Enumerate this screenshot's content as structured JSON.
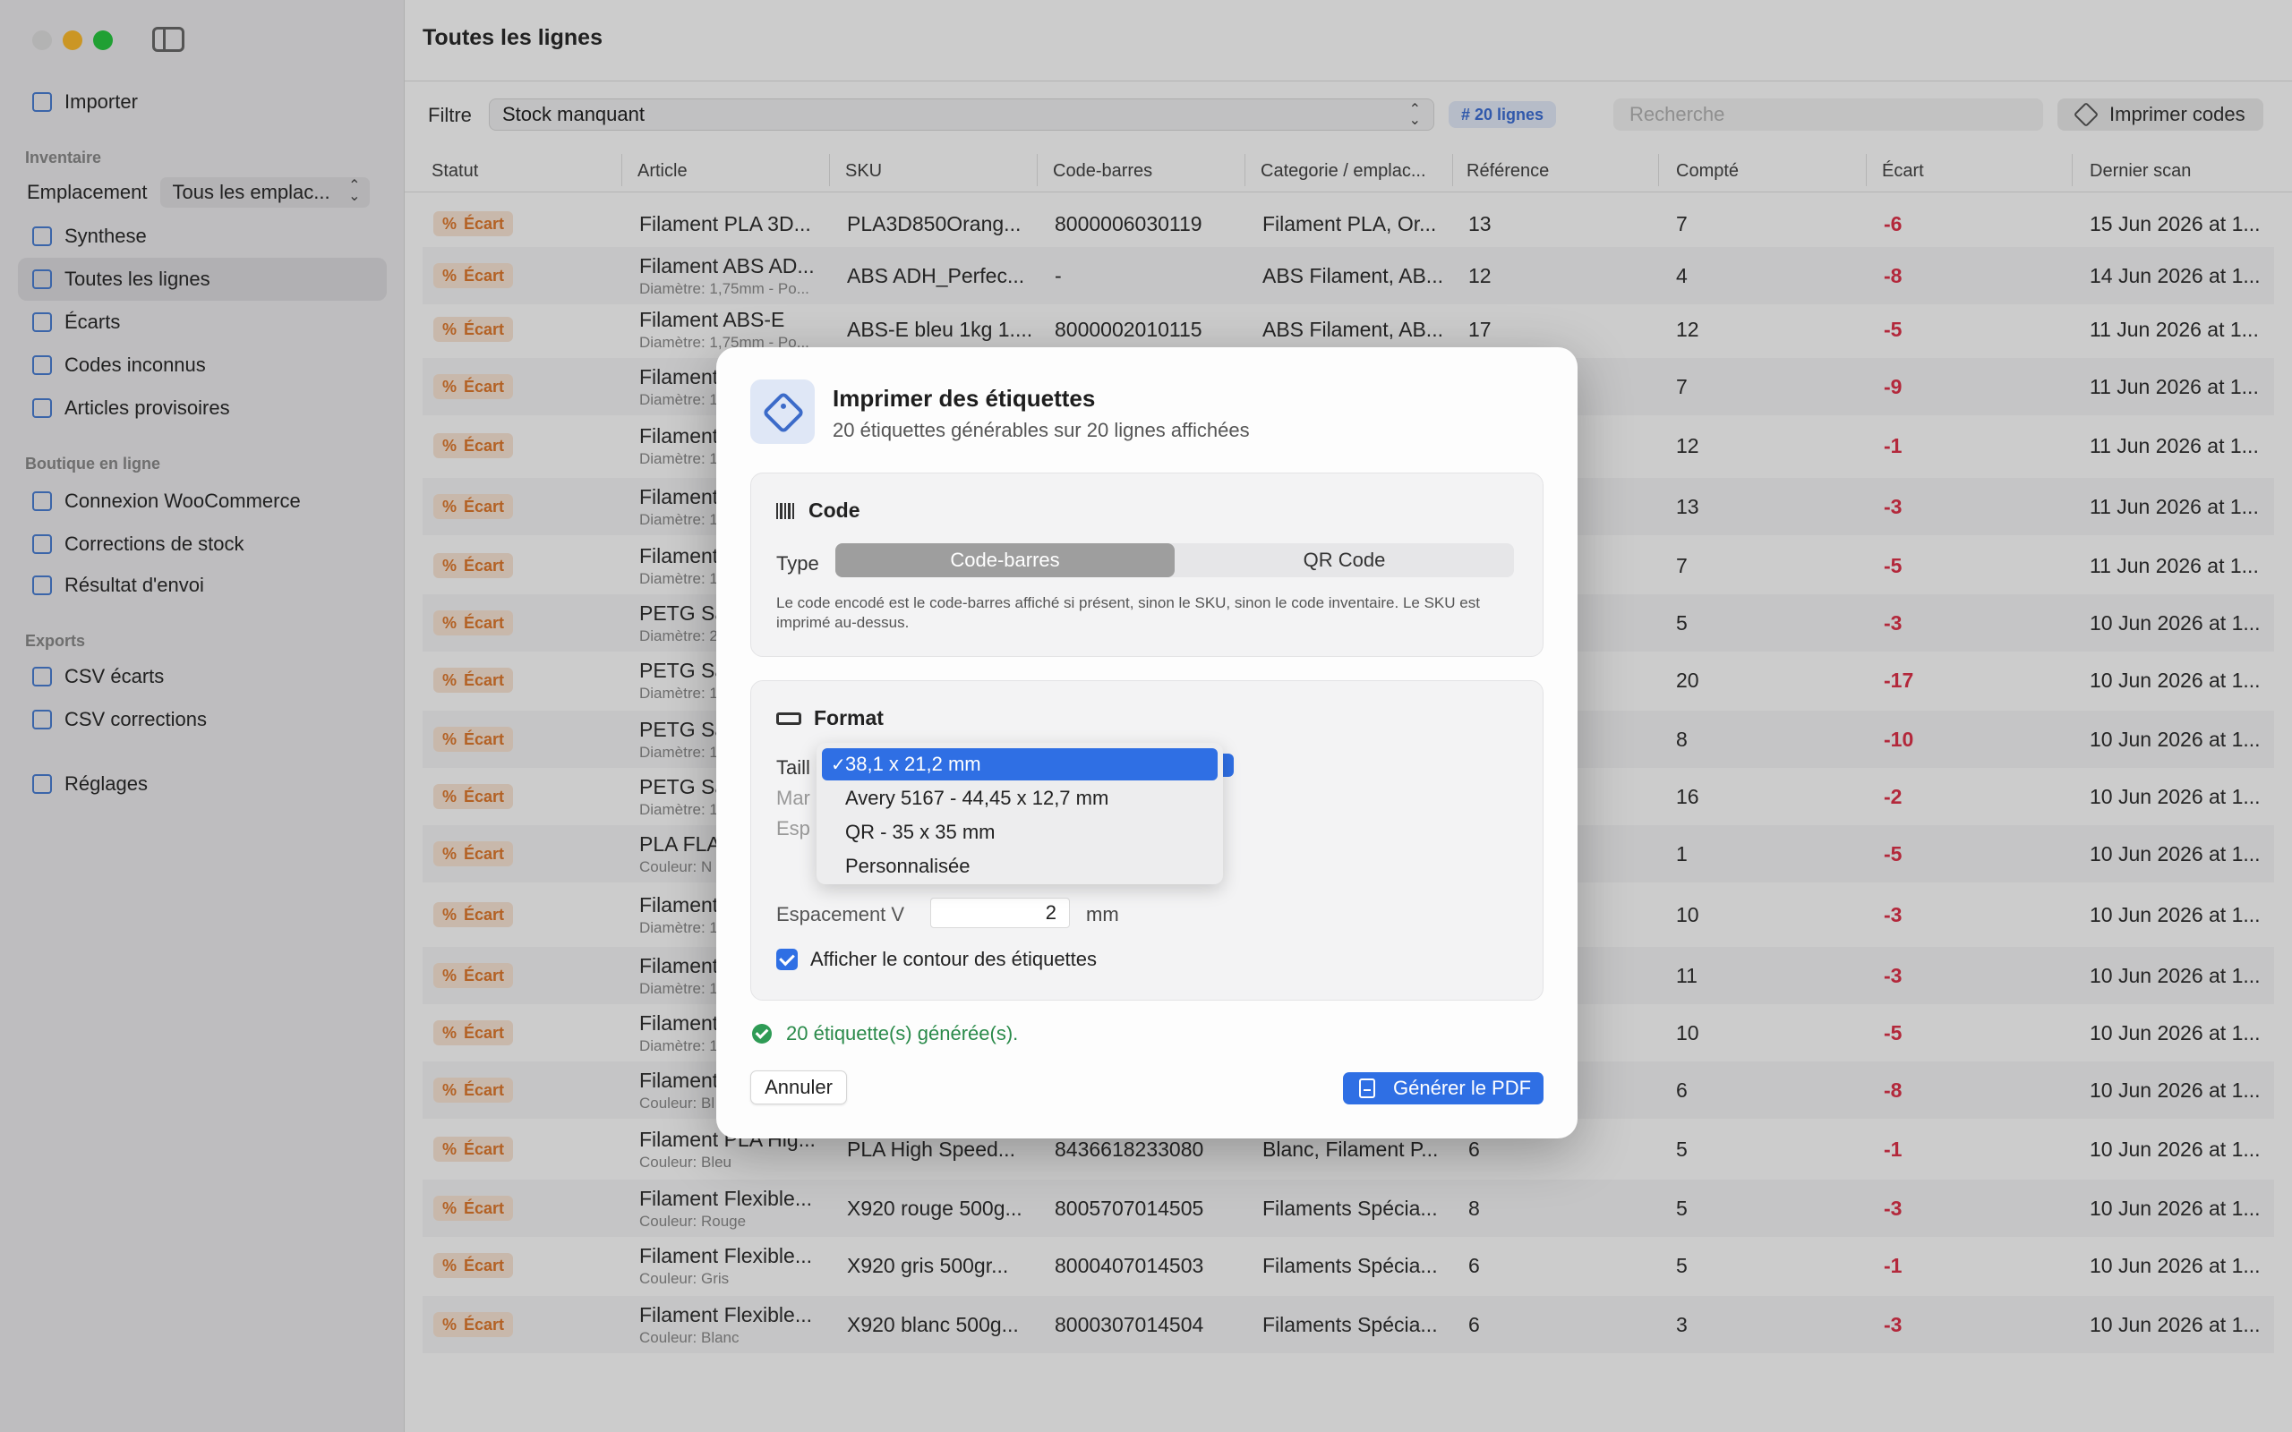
{
  "sidebar": {
    "import_label": "Importer",
    "section_inventory": "Inventaire",
    "location_label": "Emplacement",
    "location_value": "Tous les emplac...",
    "items_inventory": [
      {
        "label": "Synthese",
        "icon": "summary-icon"
      },
      {
        "label": "Toutes les lignes",
        "icon": "table-icon",
        "selected": true
      },
      {
        "label": "Écarts",
        "icon": "percent-icon"
      },
      {
        "label": "Codes inconnus",
        "icon": "unknown-code-icon"
      },
      {
        "label": "Articles provisoires",
        "icon": "box-icon"
      }
    ],
    "section_shop": "Boutique en ligne",
    "items_shop": [
      {
        "label": "Connexion WooCommerce",
        "icon": "globe-icon"
      },
      {
        "label": "Corrections de stock",
        "icon": "list-icon"
      },
      {
        "label": "Résultat d'envoi",
        "icon": "document-icon"
      }
    ],
    "section_exports": "Exports",
    "items_exports": [
      {
        "label": "CSV écarts",
        "icon": "export-icon"
      },
      {
        "label": "CSV corrections",
        "icon": "export-icon"
      }
    ],
    "settings_label": "Réglages"
  },
  "main": {
    "title": "Toutes les lignes",
    "filter_label": "Filtre",
    "filter_value": "Stock manquant",
    "count_badge": "# 20 lignes",
    "search_placeholder": "Recherche",
    "print_codes_label": "Imprimer codes",
    "columns": [
      "Statut",
      "Article",
      "SKU",
      "Code-barres",
      "Categorie / emplac...",
      "Référence",
      "Compté",
      "Écart",
      "Dernier scan"
    ],
    "rows": [
      {
        "status": "Écart",
        "article": "Filament PLA 3D...",
        "sub": "",
        "sku": "PLA3D850Orang...",
        "barcode": "8000006030119",
        "category": "Filament PLA, Or...",
        "reference": "13",
        "counted": "7",
        "ecart": "-6",
        "last_scan": "15 Jun 2026 at 1..."
      },
      {
        "status": "Écart",
        "article": "Filament ABS AD...",
        "sub": "Diamètre: 1,75mm - Po...",
        "sku": "ABS ADH_Perfec...",
        "barcode": "-",
        "category": "ABS Filament, AB...",
        "reference": "12",
        "counted": "4",
        "ecart": "-8",
        "last_scan": "14 Jun 2026 at 1..."
      },
      {
        "status": "Écart",
        "article": "Filament ABS-E",
        "sub": "Diamètre: 1,75mm - Po...",
        "sku": "ABS-E bleu 1kg 1....",
        "barcode": "8000002010115",
        "category": "ABS Filament, AB...",
        "reference": "17",
        "counted": "12",
        "ecart": "-5",
        "last_scan": "11 Jun 2026 at 1..."
      },
      {
        "status": "Écart",
        "article": "Filament",
        "sub": "Diamètre: 1",
        "sku": "",
        "barcode": "",
        "category": "",
        "reference": "",
        "counted": "7",
        "ecart": "-9",
        "last_scan": "11 Jun 2026 at 1..."
      },
      {
        "status": "Écart",
        "article": "Filament",
        "sub": "Diamètre: 1",
        "sku": "",
        "barcode": "",
        "category": "",
        "reference": "",
        "counted": "12",
        "ecart": "-1",
        "last_scan": "11 Jun 2026 at 1..."
      },
      {
        "status": "Écart",
        "article": "Filament",
        "sub": "Diamètre: 1",
        "sku": "",
        "barcode": "",
        "category": "",
        "reference": "",
        "counted": "13",
        "ecart": "-3",
        "last_scan": "11 Jun 2026 at 1..."
      },
      {
        "status": "Écart",
        "article": "Filament",
        "sub": "Diamètre: 1",
        "sku": "",
        "barcode": "",
        "category": "",
        "reference": "",
        "counted": "7",
        "ecart": "-5",
        "last_scan": "11 Jun 2026 at 1..."
      },
      {
        "status": "Écart",
        "article": "PETG Sa",
        "sub": "Diamètre: 2",
        "sku": "",
        "barcode": "",
        "category": "",
        "reference": "",
        "counted": "5",
        "ecart": "-3",
        "last_scan": "10 Jun 2026 at 1..."
      },
      {
        "status": "Écart",
        "article": "PETG Sa",
        "sub": "Diamètre: 1",
        "sku": "",
        "barcode": "",
        "category": "",
        "reference": "",
        "counted": "20",
        "ecart": "-17",
        "last_scan": "10 Jun 2026 at 1..."
      },
      {
        "status": "Écart",
        "article": "PETG Sa",
        "sub": "Diamètre: 1",
        "sku": "",
        "barcode": "",
        "category": "",
        "reference": "",
        "counted": "8",
        "ecart": "-10",
        "last_scan": "10 Jun 2026 at 1..."
      },
      {
        "status": "Écart",
        "article": "PETG Sa",
        "sub": "Diamètre: 1",
        "sku": "",
        "barcode": "",
        "category": "",
        "reference": "",
        "counted": "16",
        "ecart": "-2",
        "last_scan": "10 Jun 2026 at 1..."
      },
      {
        "status": "Écart",
        "article": "PLA FLA",
        "sub": "Couleur: N",
        "sku": "",
        "barcode": "",
        "category": "",
        "reference": "",
        "counted": "1",
        "ecart": "-5",
        "last_scan": "10 Jun 2026 at 1..."
      },
      {
        "status": "Écart",
        "article": "Filament",
        "sub": "Diamètre: 1",
        "sku": "",
        "barcode": "",
        "category": "",
        "reference": "",
        "counted": "10",
        "ecart": "-3",
        "last_scan": "10 Jun 2026 at 1..."
      },
      {
        "status": "Écart",
        "article": "Filament",
        "sub": "Diamètre: 1",
        "sku": "",
        "barcode": "",
        "category": "",
        "reference": "",
        "counted": "11",
        "ecart": "-3",
        "last_scan": "10 Jun 2026 at 1..."
      },
      {
        "status": "Écart",
        "article": "Filament",
        "sub": "Diamètre: 1",
        "sku": "",
        "barcode": "",
        "category": "",
        "reference": "",
        "counted": "10",
        "ecart": "-5",
        "last_scan": "10 Jun 2026 at 1..."
      },
      {
        "status": "Écart",
        "article": "Filament",
        "sub": "Couleur: Bl",
        "sku": "",
        "barcode": "",
        "category": "",
        "reference": "",
        "counted": "6",
        "ecart": "-8",
        "last_scan": "10 Jun 2026 at 1..."
      },
      {
        "status": "Écart",
        "article": "Filament PLA Hig...",
        "sub": "Couleur: Bleu",
        "sku": "PLA High Speed...",
        "barcode": "8436618233080",
        "category": "Blanc, Filament P...",
        "reference": "6",
        "counted": "5",
        "ecart": "-1",
        "last_scan": "10 Jun 2026 at 1..."
      },
      {
        "status": "Écart",
        "article": "Filament Flexible...",
        "sub": "Couleur: Rouge",
        "sku": "X920 rouge 500g...",
        "barcode": "8005707014505",
        "category": "Filaments Spécia...",
        "reference": "8",
        "counted": "5",
        "ecart": "-3",
        "last_scan": "10 Jun 2026 at 1..."
      },
      {
        "status": "Écart",
        "article": "Filament Flexible...",
        "sub": "Couleur: Gris",
        "sku": "X920 gris 500gr...",
        "barcode": "8000407014503",
        "category": "Filaments Spécia...",
        "reference": "6",
        "counted": "5",
        "ecart": "-1",
        "last_scan": "10 Jun 2026 at 1..."
      },
      {
        "status": "Écart",
        "article": "Filament Flexible...",
        "sub": "Couleur: Blanc",
        "sku": "X920 blanc 500g...",
        "barcode": "8000307014504",
        "category": "Filaments Spécia...",
        "reference": "6",
        "counted": "3",
        "ecart": "-3",
        "last_scan": "10 Jun 2026 at 1..."
      }
    ]
  },
  "modal": {
    "title": "Imprimer des étiquettes",
    "subtitle": "20 étiquettes générables sur 20 lignes affichées",
    "code_section_title": "Code",
    "type_label": "Type",
    "type_options": [
      "Code-barres",
      "QR Code"
    ],
    "type_selected": "Code-barres",
    "code_help": "Le code encodé est le code-barres affiché si présent, sinon le SKU, sinon le code inventaire. Le SKU est imprimé au-dessus.",
    "format_section_title": "Format",
    "size_label_partial": "Taill",
    "margin_label_partial": "Mar",
    "spacing_label_partial": "Esp",
    "size_options": [
      "38,1 x 21,2 mm",
      "Avery 5167 - 44,45 x 12,7 mm",
      "QR - 35 x 35 mm",
      "Personnalisée"
    ],
    "size_selected": "38,1 x 21,2 mm",
    "vertical_spacing_label": "Espacement V",
    "vertical_spacing_value": "2",
    "vertical_spacing_unit": "mm",
    "show_outline_label": "Afficher le contour des étiquettes",
    "show_outline_checked": true,
    "status_text": "20 étiquette(s) générée(s).",
    "cancel_label": "Annuler",
    "generate_label": "Générer le PDF"
  },
  "colors": {
    "accent": "#2f6fe4",
    "ecart_text": "#e0334a",
    "badge_bg": "#fbe7d6",
    "badge_text": "#e07a2e",
    "success": "#2e9b55"
  }
}
